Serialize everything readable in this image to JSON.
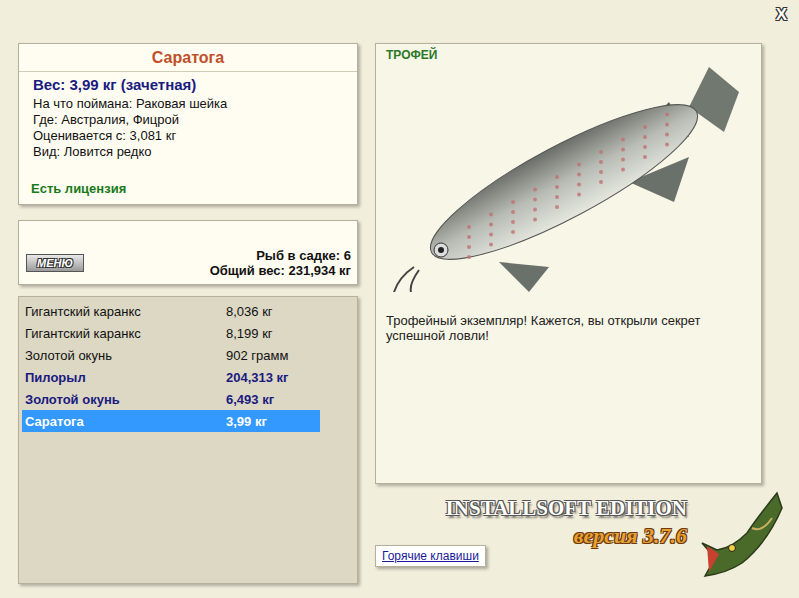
{
  "window": {
    "close": "X"
  },
  "fish_card": {
    "name": "Саратога",
    "weight": "Вес: 3,99 кг (зачетная)",
    "details": [
      "На что поймана: Раковая шейка",
      "Где: Австралия, Фицрой",
      "Оценивается с: 3,081 кг",
      "Вид: Ловится редко"
    ],
    "license": "Есть лицензия"
  },
  "keepnet": {
    "menu_button": "МЕНЮ",
    "count": "Рыб в садке: 6",
    "total": "Общий вес: 231,934 кг"
  },
  "catch_list": [
    {
      "name": "Гигантский каранкс",
      "weight": "8,036 кг",
      "trophy": false,
      "selected": false
    },
    {
      "name": "Гигантский каранкс",
      "weight": "8,199 кг",
      "trophy": false,
      "selected": false
    },
    {
      "name": "Золотой окунь",
      "weight": "902 грамм",
      "trophy": false,
      "selected": false
    },
    {
      "name": "Пилорыл",
      "weight": "204,313 кг",
      "trophy": true,
      "selected": false
    },
    {
      "name": "Золотой окунь",
      "weight": "6,493 кг",
      "trophy": true,
      "selected": false
    },
    {
      "name": "Саратога",
      "weight": "3,99 кг",
      "trophy": false,
      "selected": true
    }
  ],
  "trophy_panel": {
    "badge": "ТРОФЕЙ",
    "message": "Трофейный экземпляр! Кажется, вы открыли секрет успешной ловли!"
  },
  "branding": {
    "edition": "INSTALLSOFT EDITION",
    "version": "версия 3.7.6"
  },
  "hotkeys_button": "Горячие клавиши"
}
